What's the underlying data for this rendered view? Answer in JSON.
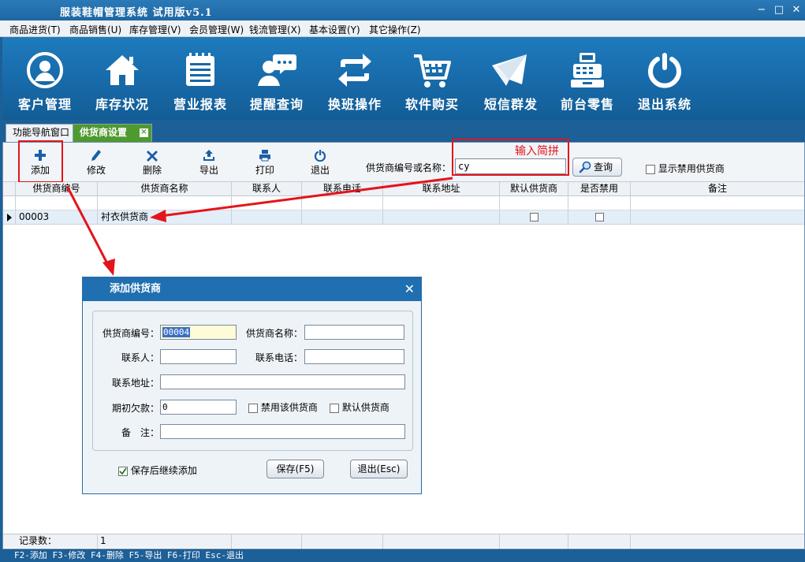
{
  "app": {
    "title": "服装鞋帽管理系统 试用版v5.1"
  },
  "window_controls": [
    "−",
    "□",
    "✕"
  ],
  "menu": [
    {
      "label": "商品进货(T)"
    },
    {
      "label": "商品销售(U)"
    },
    {
      "label": "库存管理(V)"
    },
    {
      "label": "会员管理(W)"
    },
    {
      "label": "钱流管理(X)"
    },
    {
      "label": "基本设置(Y)"
    },
    {
      "label": "其它操作(Z)"
    }
  ],
  "nav": [
    {
      "label": "客户管理",
      "icon": "customer-icon"
    },
    {
      "label": "库存状况",
      "icon": "home-icon"
    },
    {
      "label": "营业报表",
      "icon": "report-icon"
    },
    {
      "label": "提醒查询",
      "icon": "reminder-icon"
    },
    {
      "label": "换班操作",
      "icon": "swap-icon"
    },
    {
      "label": "软件购买",
      "icon": "cart-icon"
    },
    {
      "label": "短信群发",
      "icon": "mail-icon"
    },
    {
      "label": "前台零售",
      "icon": "register-icon"
    },
    {
      "label": "退出系统",
      "icon": "power-icon"
    }
  ],
  "tabs": [
    {
      "label": "功能导航窗口"
    },
    {
      "label": "供货商设置"
    }
  ],
  "toolbar": {
    "add": "添加",
    "edit": "修改",
    "delete": "删除",
    "export": "导出",
    "print": "打印",
    "exit": "退出",
    "search_label": "供货商编号或名称：",
    "search_value": "cy",
    "query": "查询",
    "show_disabled": "显示禁用供货商",
    "hint": "输入简拼"
  },
  "grid": {
    "columns": [
      "供货商编号",
      "供货商名称",
      "联系人",
      "联系电话",
      "联系地址",
      "默认供货商",
      "是否禁用",
      "备注"
    ],
    "rows": [
      {
        "id": "00003",
        "name": "衬衣供货商",
        "contact": "",
        "phone": "",
        "address": "",
        "default": false,
        "disabled": false,
        "note": ""
      }
    ],
    "footer_label": "记录数：",
    "footer_count": "1"
  },
  "dialog": {
    "title": "添加供货商",
    "code_label": "供货商编号：",
    "code_value": "00004",
    "name_label": "供货商名称：",
    "contact_label": "联系人：",
    "phone_label": "联系电话：",
    "address_label": "联系地址：",
    "debt_label": "期初欠款：",
    "debt_value": "0",
    "disable_label": "禁用该供货商",
    "default_label": "默认供货商",
    "note_label": "备　注：",
    "continue_label": "保存后继续添加",
    "continue_checked": true,
    "save": "保存(F5)",
    "exit": "退出(Esc)"
  },
  "statusbar": "F2-添加 F3-修改 F4-删除 F5-导出 F6-打印 Esc-退出",
  "colors": {
    "accent": "#1d5f97",
    "nav_bg": "#1a6fad",
    "active_tab": "#4e9a2e",
    "annotation": "#e4141b"
  }
}
